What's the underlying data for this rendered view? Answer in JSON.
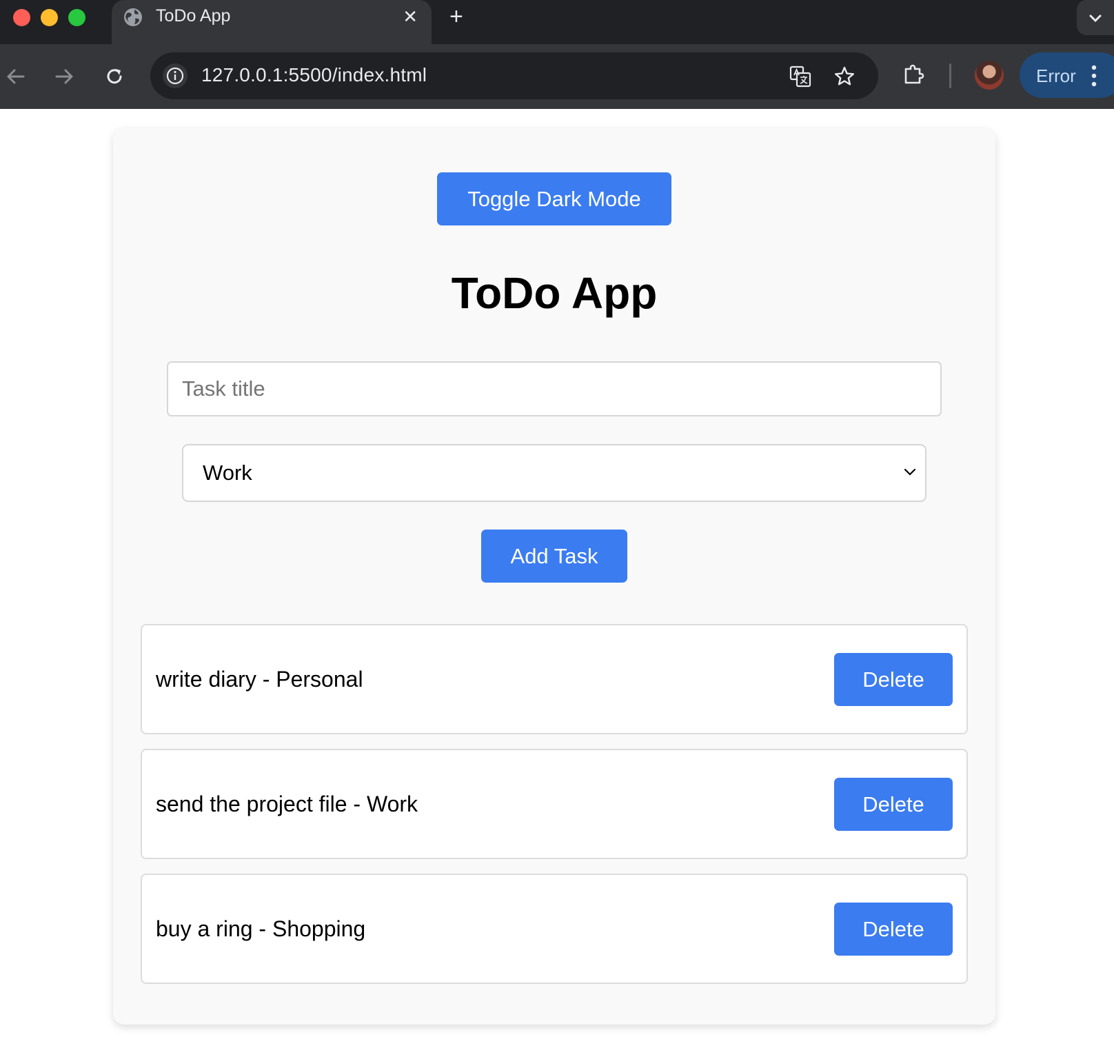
{
  "browser": {
    "tab_title": "ToDo App",
    "url": "127.0.0.1:5500/index.html",
    "profile_status": "Error"
  },
  "colors": {
    "accent": "#3b7cf0",
    "card_background": "#f9f9f9",
    "chrome_dark": "#202124",
    "chrome_toolbar": "#35363a"
  },
  "app": {
    "toggle_label": "Toggle Dark Mode",
    "title": "ToDo App",
    "task_input": {
      "placeholder": "Task title",
      "value": ""
    },
    "category_select": {
      "selected": "Work"
    },
    "add_label": "Add Task"
  },
  "tasks": [
    {
      "text": "write diary - Personal",
      "delete_label": "Delete"
    },
    {
      "text": "send the project file - Work",
      "delete_label": "Delete"
    },
    {
      "text": "buy a ring - Shopping",
      "delete_label": "Delete"
    }
  ]
}
